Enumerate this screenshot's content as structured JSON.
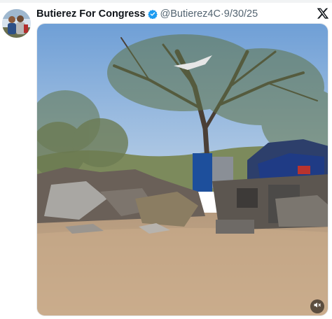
{
  "post": {
    "author_name": "Butierez For Congress",
    "handle": "@Butierez4C",
    "separator": "·",
    "date": "9/30/25"
  },
  "icons": {
    "verified": "verified-badge-icon",
    "platform": "x-logo-icon",
    "mute": "speaker-muted-icon"
  },
  "colors": {
    "verified_blue": "#1d9bf0",
    "text_primary": "#0f1419",
    "text_secondary": "#536471"
  }
}
